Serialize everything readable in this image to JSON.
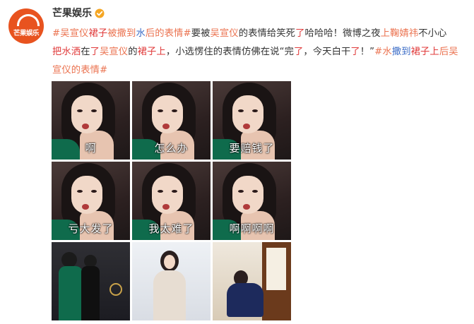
{
  "account": {
    "name": "芒果娱乐",
    "avatar_text": "芒果娱乐",
    "verified_icon": "verified-badge-icon"
  },
  "post": {
    "line1": [
      {
        "t": "#吴宣仪",
        "c": "tag"
      },
      {
        "t": "裙子",
        "c": "red"
      },
      {
        "t": "被撒到",
        "c": "tag"
      },
      {
        "t": "水",
        "c": "blue"
      },
      {
        "t": "后的表情#",
        "c": "tag"
      },
      {
        "t": "要被",
        "c": "plain"
      },
      {
        "t": "吴宣仪",
        "c": "mention"
      },
      {
        "t": "的表情给笑死",
        "c": "plain"
      },
      {
        "t": "了",
        "c": "red"
      },
      {
        "t": "哈哈哈！微博之夜",
        "c": "plain"
      },
      {
        "t": "上鞠婧祎",
        "c": "mention"
      },
      {
        "t": "不小心",
        "c": "plain"
      }
    ],
    "line2": [
      {
        "t": "把水洒",
        "c": "red"
      },
      {
        "t": "在",
        "c": "plain"
      },
      {
        "t": "了",
        "c": "red"
      },
      {
        "t": "吴宣仪",
        "c": "mention"
      },
      {
        "t": "的",
        "c": "plain"
      },
      {
        "t": "裙子上",
        "c": "red"
      },
      {
        "t": "，小选愣住的表情仿佛在说“完",
        "c": "plain"
      },
      {
        "t": "了",
        "c": "red"
      },
      {
        "t": "，今天白干",
        "c": "plain"
      },
      {
        "t": "了",
        "c": "red"
      },
      {
        "t": "！”",
        "c": "plain"
      },
      {
        "t": "#水",
        "c": "tag"
      },
      {
        "t": "撒到",
        "c": "blue"
      },
      {
        "t": "裙子上",
        "c": "red"
      },
      {
        "t": "后吴",
        "c": "tag"
      }
    ],
    "line3": [
      {
        "t": "宣仪的表情#",
        "c": "tag"
      }
    ]
  },
  "images": {
    "captions": [
      "啊",
      "怎么办",
      "要赔钱了",
      "亏大发了",
      "我太难了",
      "啊啊啊啊"
    ],
    "photo_names": [
      "event-photo-green-gown",
      "event-photo-white-gown",
      "event-photo-seated-blue-gown"
    ]
  }
}
